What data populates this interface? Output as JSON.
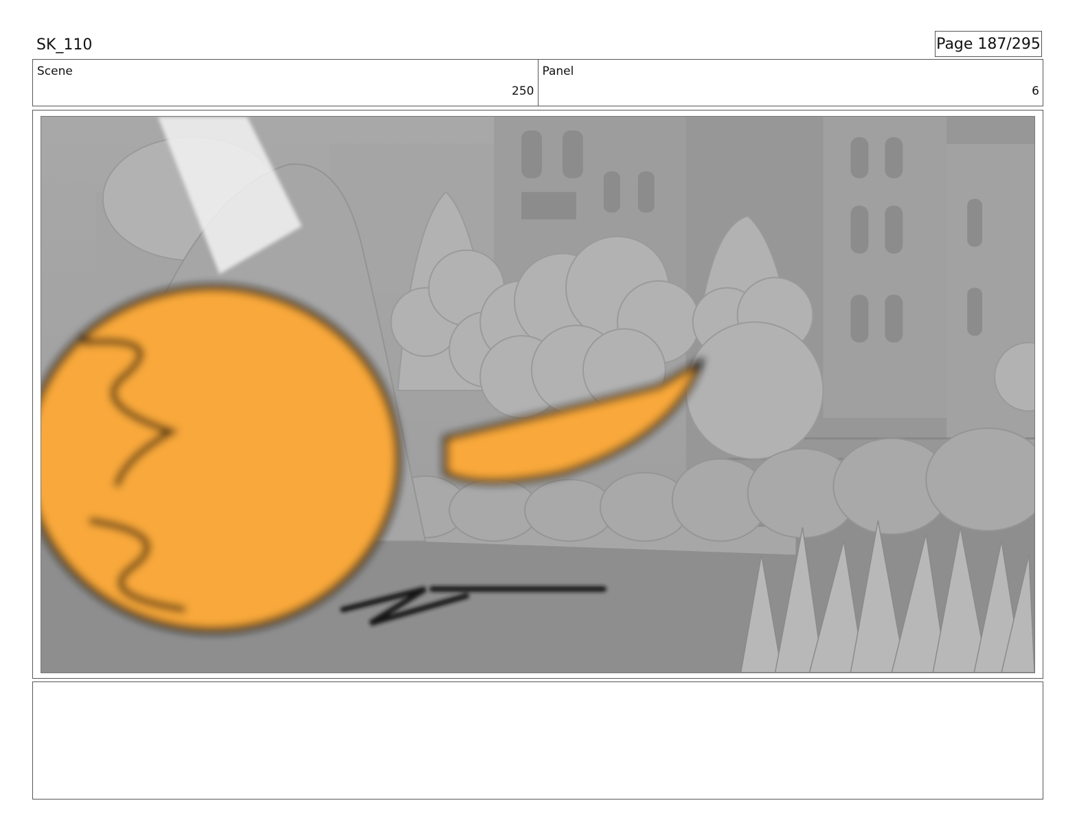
{
  "header": {
    "project_code": "SK_110",
    "page_label": "Page 187/295"
  },
  "info": {
    "scene_label": "Scene",
    "scene_value": "250",
    "panel_label": "Panel",
    "panel_value": "6"
  },
  "frame": {
    "palette": {
      "sky": "#a3a3a3",
      "building": "#9a9a9a",
      "foliage": "#b3b3b3",
      "ground": "#8e8e8e",
      "character": "#f9a93a",
      "outline": "#111111"
    }
  },
  "notes": {
    "text": ""
  }
}
